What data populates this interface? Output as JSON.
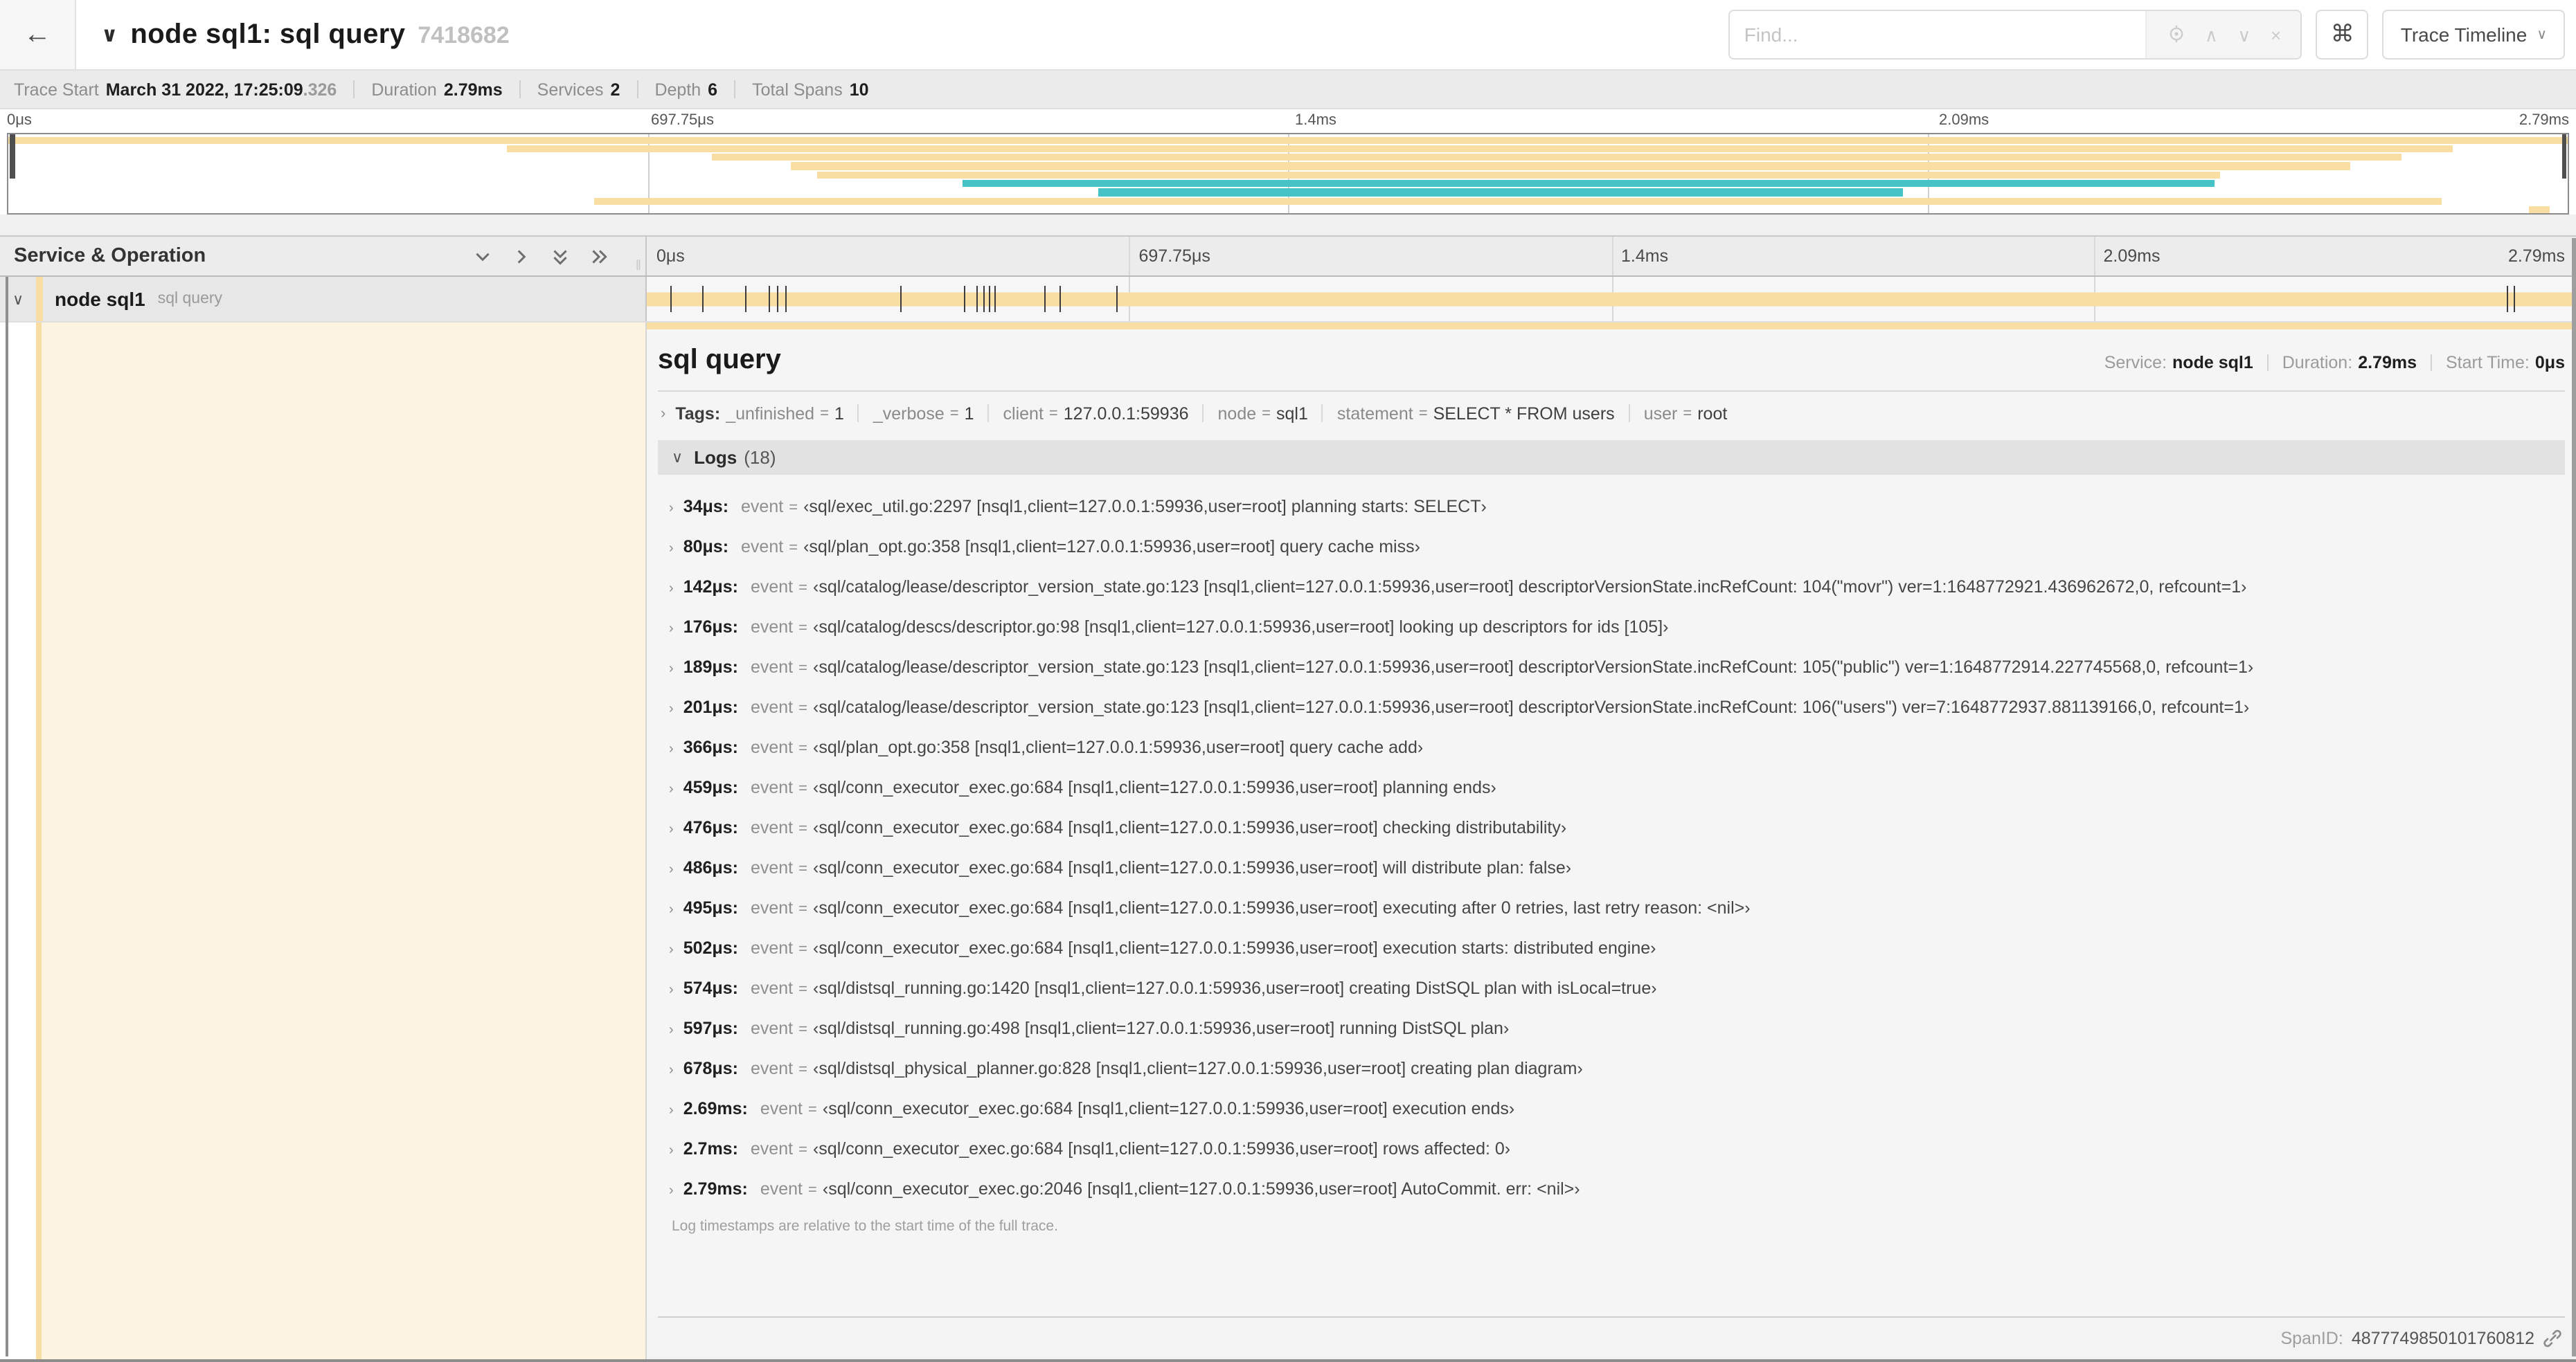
{
  "colors": {
    "tan": "#F8DEA2",
    "teal": "#45C3C7",
    "cream": "#FCF4E1",
    "tick": "#3c3c3c"
  },
  "icons": {
    "back": "←",
    "chevron_down": "∨",
    "chevron_right": "›",
    "command": "⌘",
    "up": "∧",
    "down": "∨",
    "close": "×",
    "grip": "‖"
  },
  "header": {
    "collapse_icon": "∨",
    "title": "node sql1: sql query",
    "trace_id_short": "7418682",
    "find_placeholder": "Find...",
    "view_selector_label": "Trace Timeline"
  },
  "trace_info": [
    {
      "label": "Trace Start",
      "value": "March 31 2022, 17:25:09",
      "suffix": ".326"
    },
    {
      "label": "Duration",
      "value": "2.79ms",
      "suffix": ""
    },
    {
      "label": "Services",
      "value": "2",
      "suffix": ""
    },
    {
      "label": "Depth",
      "value": "6",
      "suffix": ""
    },
    {
      "label": "Total Spans",
      "value": "10",
      "suffix": ""
    }
  ],
  "timeline": {
    "header_label": "Service & Operation",
    "duration_us": 2790,
    "ticks": [
      {
        "label": "0μs",
        "pct": 0
      },
      {
        "label": "697.75μs",
        "pct": 25
      },
      {
        "label": "1.4ms",
        "pct": 50
      },
      {
        "label": "2.09ms",
        "pct": 75
      },
      {
        "label": "2.79ms",
        "pct": 100
      }
    ]
  },
  "minimap": {
    "spans": [
      {
        "left": 0,
        "width": 100,
        "color": "tan"
      },
      {
        "left": 19.5,
        "width": 76,
        "color": "tan"
      },
      {
        "left": 27.5,
        "width": 66,
        "color": "tan"
      },
      {
        "left": 30.6,
        "width": 60.9,
        "color": "tan"
      },
      {
        "left": 31.6,
        "width": 54.8,
        "color": "tan"
      },
      {
        "left": 37.3,
        "width": 48.9,
        "color": "teal"
      },
      {
        "left": 42.6,
        "width": 31.4,
        "color": "teal"
      },
      {
        "left": 22.9,
        "width": 72.2,
        "color": "tan"
      },
      {
        "left": 98.5,
        "width": 0.8,
        "color": "tan"
      }
    ]
  },
  "span_row": {
    "service": "node sql1",
    "operation": "sql query"
  },
  "detail": {
    "title": "sql query",
    "meta": [
      {
        "label": "Service:",
        "value": "node sql1"
      },
      {
        "label": "Duration:",
        "value": "2.79ms"
      },
      {
        "label": "Start Time:",
        "value": "0μs"
      }
    ],
    "tags_label": "Tags:",
    "tags": [
      {
        "key": "_unfinished",
        "value": "1"
      },
      {
        "key": "_verbose",
        "value": "1"
      },
      {
        "key": "client",
        "value": "127.0.0.1:59936"
      },
      {
        "key": "node",
        "value": "sql1"
      },
      {
        "key": "statement",
        "value": "SELECT * FROM users"
      },
      {
        "key": "user",
        "value": "root"
      }
    ],
    "logs_label": "Logs",
    "logs_count": "(18)",
    "logs": [
      {
        "time": "34μs:",
        "t_us": 34,
        "key": "event",
        "value": "‹sql/exec_util.go:2297 [nsql1,client=127.0.0.1:59936,user=root] planning starts: SELECT›"
      },
      {
        "time": "80μs:",
        "t_us": 80,
        "key": "event",
        "value": "‹sql/plan_opt.go:358 [nsql1,client=127.0.0.1:59936,user=root] query cache miss›"
      },
      {
        "time": "142μs:",
        "t_us": 142,
        "key": "event",
        "value": "‹sql/catalog/lease/descriptor_version_state.go:123 [nsql1,client=127.0.0.1:59936,user=root] descriptorVersionState.incRefCount: 104(\"movr\") ver=1:1648772921.436962672,0, refcount=1›"
      },
      {
        "time": "176μs:",
        "t_us": 176,
        "key": "event",
        "value": "‹sql/catalog/descs/descriptor.go:98 [nsql1,client=127.0.0.1:59936,user=root] looking up descriptors for ids [105]›"
      },
      {
        "time": "189μs:",
        "t_us": 189,
        "key": "event",
        "value": "‹sql/catalog/lease/descriptor_version_state.go:123 [nsql1,client=127.0.0.1:59936,user=root] descriptorVersionState.incRefCount: 105(\"public\") ver=1:1648772914.227745568,0, refcount=1›"
      },
      {
        "time": "201μs:",
        "t_us": 201,
        "key": "event",
        "value": "‹sql/catalog/lease/descriptor_version_state.go:123 [nsql1,client=127.0.0.1:59936,user=root] descriptorVersionState.incRefCount: 106(\"users\") ver=7:1648772937.881139166,0, refcount=1›"
      },
      {
        "time": "366μs:",
        "t_us": 366,
        "key": "event",
        "value": "‹sql/plan_opt.go:358 [nsql1,client=127.0.0.1:59936,user=root] query cache add›"
      },
      {
        "time": "459μs:",
        "t_us": 459,
        "key": "event",
        "value": "‹sql/conn_executor_exec.go:684 [nsql1,client=127.0.0.1:59936,user=root] planning ends›"
      },
      {
        "time": "476μs:",
        "t_us": 476,
        "key": "event",
        "value": "‹sql/conn_executor_exec.go:684 [nsql1,client=127.0.0.1:59936,user=root] checking distributability›"
      },
      {
        "time": "486μs:",
        "t_us": 486,
        "key": "event",
        "value": "‹sql/conn_executor_exec.go:684 [nsql1,client=127.0.0.1:59936,user=root] will distribute plan: false›"
      },
      {
        "time": "495μs:",
        "t_us": 495,
        "key": "event",
        "value": "‹sql/conn_executor_exec.go:684 [nsql1,client=127.0.0.1:59936,user=root] executing after 0 retries, last retry reason: <nil>›"
      },
      {
        "time": "502μs:",
        "t_us": 502,
        "key": "event",
        "value": "‹sql/conn_executor_exec.go:684 [nsql1,client=127.0.0.1:59936,user=root] execution starts: distributed engine›"
      },
      {
        "time": "574μs:",
        "t_us": 574,
        "key": "event",
        "value": "‹sql/distsql_running.go:1420 [nsql1,client=127.0.0.1:59936,user=root] creating DistSQL plan with isLocal=true›"
      },
      {
        "time": "597μs:",
        "t_us": 597,
        "key": "event",
        "value": "‹sql/distsql_running.go:498 [nsql1,client=127.0.0.1:59936,user=root] running DistSQL plan›"
      },
      {
        "time": "678μs:",
        "t_us": 678,
        "key": "event",
        "value": "‹sql/distsql_physical_planner.go:828 [nsql1,client=127.0.0.1:59936,user=root] creating plan diagram›"
      },
      {
        "time": "2.69ms:",
        "t_us": 2690,
        "key": "event",
        "value": "‹sql/conn_executor_exec.go:684 [nsql1,client=127.0.0.1:59936,user=root] execution ends›"
      },
      {
        "time": "2.7ms:",
        "t_us": 2700,
        "key": "event",
        "value": "‹sql/conn_executor_exec.go:684 [nsql1,client=127.0.0.1:59936,user=root] rows affected: 0›"
      },
      {
        "time": "2.79ms:",
        "t_us": 2790,
        "key": "event",
        "value": "‹sql/conn_executor_exec.go:2046 [nsql1,client=127.0.0.1:59936,user=root] AutoCommit. err: <nil>›"
      }
    ],
    "logs_note": "Log timestamps are relative to the start time of the full trace.",
    "span_id_label": "SpanID:",
    "span_id": "4877749850101760812"
  }
}
